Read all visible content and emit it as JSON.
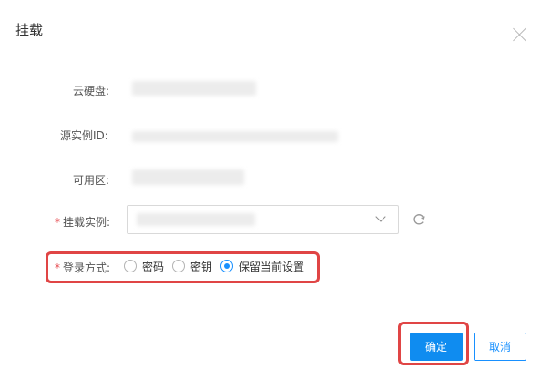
{
  "dialog": {
    "title": "挂载",
    "close_icon": "close-icon"
  },
  "form": {
    "disk_label": "云硬盘:",
    "source_instance_label": "源实例ID:",
    "zone_label": "可用区:",
    "mount_instance_label": "挂载实例:",
    "login_method_label": "登录方式:",
    "required_mark": "*",
    "dropdown_icon": "chevron-down-icon",
    "refresh_icon": "refresh-icon",
    "login_options": [
      {
        "label": "密码",
        "checked": false
      },
      {
        "label": "密钥",
        "checked": false
      },
      {
        "label": "保留当前设置",
        "checked": true
      }
    ]
  },
  "footer": {
    "confirm_label": "确定",
    "cancel_label": "取消"
  },
  "colors": {
    "primary": "#1890ff",
    "required": "#e5484d",
    "highlight": "#e04545"
  }
}
